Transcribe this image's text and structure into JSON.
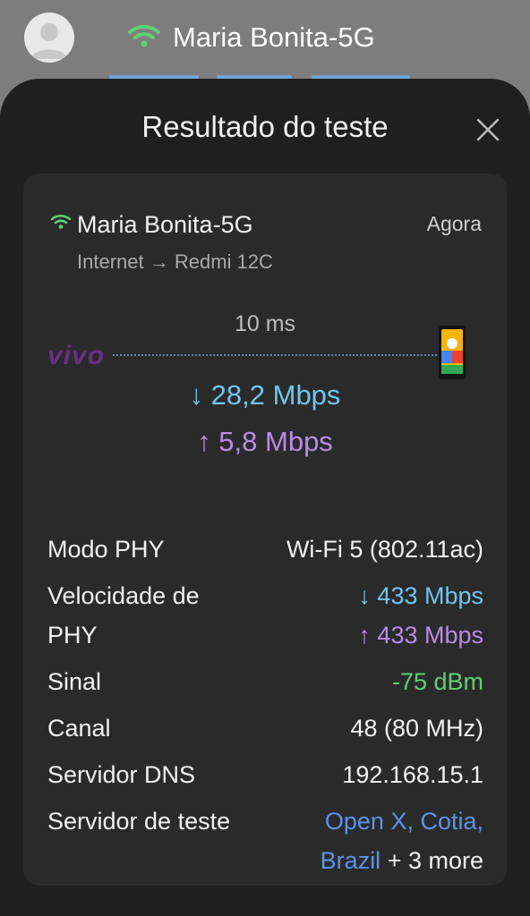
{
  "header": {
    "network_name": "Maria Bonita-5G",
    "avatar_icon": "user-avatar-icon",
    "wifi_icon": "wifi-icon"
  },
  "dialog": {
    "title": "Resultado do teste",
    "close_icon": "close-icon"
  },
  "result": {
    "network_name": "Maria Bonita-5G",
    "time": "Agora",
    "route": "Internet → Redmi 12C",
    "latency": "10 ms",
    "isp_logo_text": "vivo",
    "download": "↓ 28,2 Mbps",
    "upload": "↑ 5,8 Mbps"
  },
  "details": {
    "phy_mode_label": "Modo PHY",
    "phy_mode_value": "Wi-Fi 5 (802.11ac)",
    "phy_speed_label_line1": "Velocidade de",
    "phy_speed_label_line2": "PHY",
    "phy_speed_down": "↓ 433 Mbps",
    "phy_speed_up": "↑ 433 Mbps",
    "signal_label": "Sinal",
    "signal_value": "-75 dBm",
    "channel_label": "Canal",
    "channel_value": "48 (80 MHz)",
    "dns_label": "Servidor DNS",
    "dns_value": "192.168.15.1",
    "test_server_label": "Servidor de teste",
    "test_server_link_line1": "Open X, Cotia,",
    "test_server_link_line2": "Brazil",
    "test_server_more": " + 3 more"
  },
  "colors": {
    "download": "#6fc6ef",
    "upload": "#b98ae6",
    "signal_good": "#5fcf73",
    "link": "#5a93e8",
    "wifi": "#5fcf73",
    "isp_brand": "#6b2d86"
  }
}
